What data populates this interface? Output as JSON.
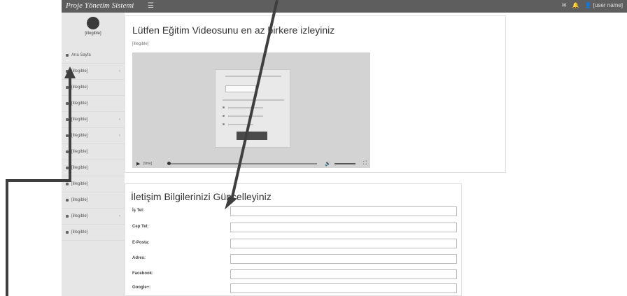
{
  "topbar": {
    "brand": "Proje Yönetim Sistemi",
    "menu_icon": "bars-icon",
    "right_icons": [
      "mail-icon",
      "bell-icon"
    ],
    "user_name": "[user name]"
  },
  "sidebar": {
    "logo_text": "[illegible]",
    "items": [
      {
        "label": "Ana Sayfa",
        "icon": "home-icon",
        "has_caret": false
      },
      {
        "label": "[illegible]",
        "icon": "folder-icon",
        "has_caret": true
      },
      {
        "label": "[illegible]",
        "icon": "lock-icon",
        "has_caret": false
      },
      {
        "label": "[illegible]",
        "icon": "doc-icon",
        "has_caret": false
      },
      {
        "label": "[illegible]",
        "icon": "people-icon",
        "has_caret": true
      },
      {
        "label": "[illegible]",
        "icon": "list-icon",
        "has_caret": true
      },
      {
        "label": "[illegible]",
        "icon": "chart-icon",
        "has_caret": false
      },
      {
        "label": "[illegible]",
        "icon": "gear-icon",
        "has_caret": false
      },
      {
        "label": "[illegible]",
        "icon": "user-icon",
        "has_caret": false
      },
      {
        "label": "[illegible]",
        "icon": "key-icon",
        "has_caret": false
      },
      {
        "label": "[illegible]",
        "icon": "star-icon",
        "has_caret": true
      },
      {
        "label": "[illegible]",
        "icon": "power-icon",
        "has_caret": false
      }
    ]
  },
  "video_card": {
    "title": "Lütfen Eğitim Videosunu en az birkere izleyiniz",
    "description": "[illegible]",
    "player": {
      "time": "[time]",
      "progress": 0.0
    }
  },
  "contact_card": {
    "title": "İletişim Bilgilerinizi Güncelleyiniz",
    "fields": [
      {
        "label": "İş Tel:",
        "value": ""
      },
      {
        "label": "Cep Tel:",
        "value": ""
      },
      {
        "label": "E-Posta:",
        "value": ""
      },
      {
        "label": "Adres:",
        "value": ""
      },
      {
        "label": "Facebook:",
        "value": ""
      },
      {
        "label": "Google+:",
        "value": ""
      }
    ]
  },
  "colors": {
    "topbar": "#5e5e5e",
    "sidebar": "#e6e6e6",
    "annotation_arrow": "#3f3f3f"
  }
}
